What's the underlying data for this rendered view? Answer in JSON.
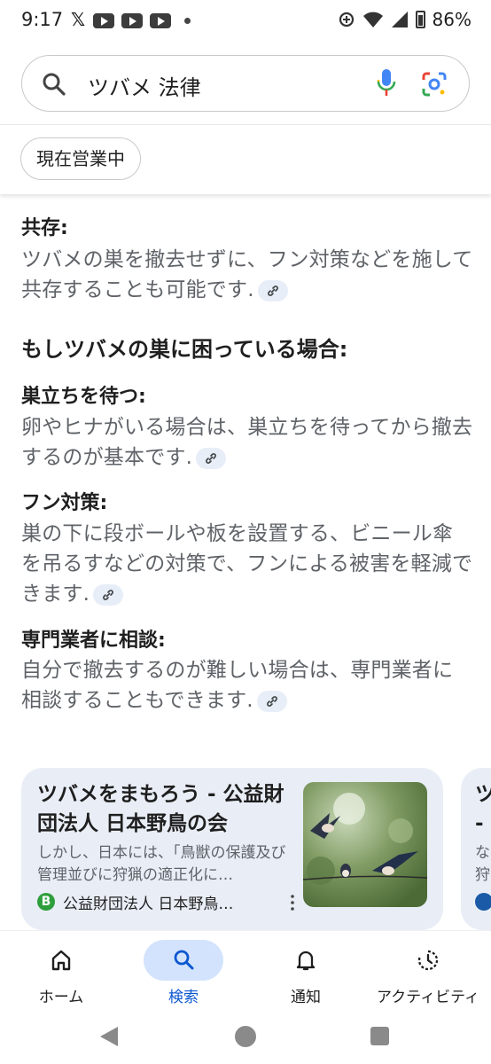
{
  "status_bar": {
    "time": "9:17",
    "x_glyph": "𝕏",
    "battery": "86%"
  },
  "search": {
    "query": "ツバメ 法律"
  },
  "filter_chip": "現在営業中",
  "content": {
    "coexist": {
      "heading": "共存:",
      "text": "ツバメの巣を撤去せずに、フン対策などを施して共存することも可能です."
    },
    "if_troubled_heading": "もしツバメの巣に困っている場合:",
    "items": [
      {
        "heading": "巣立ちを待つ:",
        "text": "卵やヒナがいる場合は、巣立ちを待ってから撤去するのが基本です."
      },
      {
        "heading": "フン対策:",
        "text": "巣の下に段ボールや板を設置する、ビニール傘を吊るすなどの対策で、フンによる被害を軽減できます."
      },
      {
        "heading": "専門業者に相談:",
        "text": "自分で撤去するのが難しい場合は、専門業者に相談することもできます."
      }
    ]
  },
  "cards": [
    {
      "title": "ツバメをまもろう - 公益財団法人 日本野鳥の会",
      "snippet": "しかし、日本には、「鳥獣の保護及び管理並びに狩猟の適正化に…",
      "favicon_letter": "B",
      "source": "公益財団法人 日本野鳥…"
    },
    {
      "title": "ツ",
      "title_line2": "-",
      "snippet_line1": "な",
      "snippet_line2": "狩"
    }
  ],
  "bottom_nav": [
    {
      "label": "ホーム",
      "icon": "home-icon",
      "active": false
    },
    {
      "label": "検索",
      "icon": "search-icon",
      "active": true
    },
    {
      "label": "通知",
      "icon": "bell-icon",
      "active": false
    },
    {
      "label": "アクティビティ",
      "icon": "activity-icon",
      "active": false
    }
  ],
  "colors": {
    "accent": "#0b57d0",
    "active_pill": "#d3e3fd",
    "card_bg": "#e9eef6",
    "body_text": "#5f6368"
  }
}
